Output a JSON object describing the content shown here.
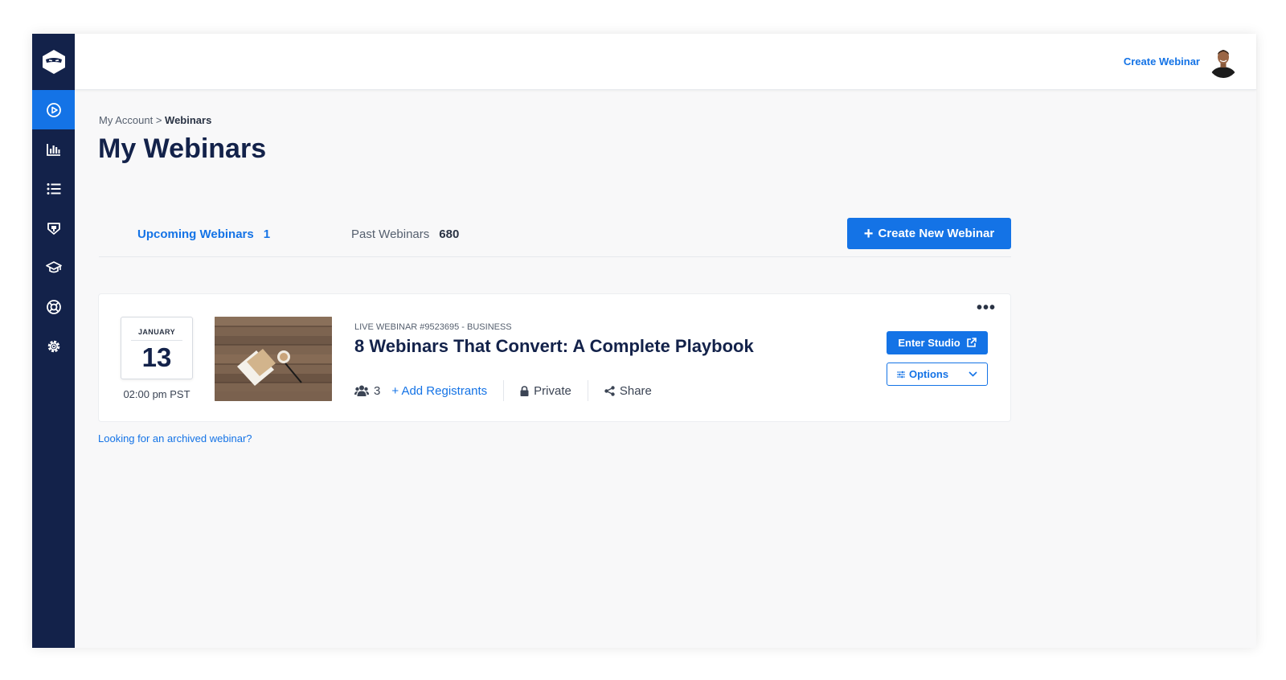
{
  "colors": {
    "sidebar_bg": "#13224a",
    "accent": "#1473e6",
    "page_bg": "#f8f8f9"
  },
  "sidebar": {
    "logo_icon": "ninja-logo-icon",
    "items": [
      {
        "icon": "play-circle-icon",
        "active": true
      },
      {
        "icon": "bar-chart-icon",
        "active": false
      },
      {
        "icon": "list-icon",
        "active": false
      },
      {
        "icon": "integrations-icon",
        "active": false
      },
      {
        "icon": "graduation-cap-icon",
        "active": false
      },
      {
        "icon": "lifebuoy-icon",
        "active": false
      },
      {
        "icon": "gear-icon",
        "active": false
      }
    ]
  },
  "header": {
    "create_label": "Create Webinar",
    "avatar_icon": "user-avatar"
  },
  "breadcrumb": {
    "parent": "My Account",
    "separator": ">",
    "current": "Webinars"
  },
  "page_title": "My Webinars",
  "tabs": {
    "upcoming_label": "Upcoming Webinars",
    "upcoming_count": "1",
    "past_label": "Past Webinars",
    "past_count": "680"
  },
  "create_new_label": "Create New Webinar",
  "webinar": {
    "month": "JANUARY",
    "day": "13",
    "time": "02:00 pm PST",
    "meta": "LIVE WEBINAR #9523695 - BUSINESS",
    "title": "8 Webinars That Convert: A Complete Playbook",
    "registrant_count": "3",
    "add_registrants": "+ Add Registrants",
    "privacy": "Private",
    "share": "Share",
    "enter_studio": "Enter Studio",
    "options": "Options",
    "more": "•••"
  },
  "archived_link": "Looking for an archived webinar?"
}
